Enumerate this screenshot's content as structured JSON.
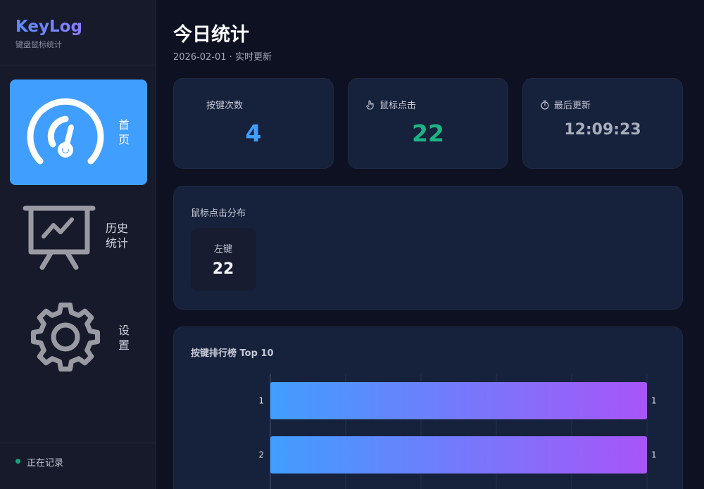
{
  "brand": {
    "title": "KeyLog",
    "subtitle": "键盘鼠标统计"
  },
  "nav": [
    {
      "id": "home",
      "label": "首页",
      "icon": "dashboard-gauge-icon",
      "active": true
    },
    {
      "id": "history",
      "label": "历史统计",
      "icon": "presentation-chart-icon",
      "active": false
    },
    {
      "id": "settings",
      "label": "设置",
      "icon": "gear-icon",
      "active": false
    }
  ],
  "status": {
    "text": "正在记录",
    "color": "#1aa37a"
  },
  "header": {
    "title": "今日统计",
    "subtitle": "2026-02-01 · 实时更新"
  },
  "stats": {
    "keys": {
      "label": "按键次数",
      "value": "4",
      "color": "#409eff"
    },
    "clicks": {
      "label": "鼠标点击",
      "value": "22",
      "color": "#1bb583",
      "icon": "pointer-hand-icon"
    },
    "updated": {
      "label": "最后更新",
      "value": "12:09:23",
      "color": "#a7aebd",
      "icon": "stopwatch-icon"
    }
  },
  "clickDistribution": {
    "title": "鼠标点击分布",
    "items": [
      {
        "label": "左键",
        "value": "22"
      }
    ]
  },
  "keyRanking": {
    "title": "按键排行榜 Top 10",
    "chart_data": {
      "type": "bar",
      "orientation": "horizontal",
      "categories": [
        "1",
        "2"
      ],
      "values": [
        1,
        1
      ],
      "xlim": [
        0,
        1
      ],
      "grid": true,
      "gradient": [
        "#409eff",
        "#a855f7"
      ]
    }
  }
}
